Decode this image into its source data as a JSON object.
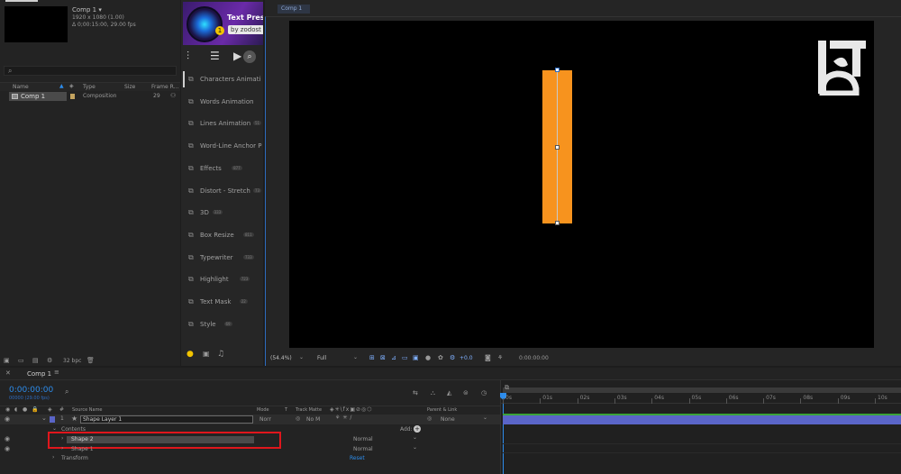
{
  "project": {
    "comp_name": "Comp 1 ▾",
    "comp_info_1": "1920 x 1080 (1.00)",
    "comp_info_2": "Δ 0;00:15:00, 29.00 fps",
    "columns": {
      "name": "Name",
      "type": "Type",
      "size": "Size",
      "frame_rate": "Frame R..."
    },
    "items": [
      {
        "name": "Comp 1",
        "type": "Composition",
        "size": "",
        "frame_rate": "29"
      }
    ],
    "bpc": "32 bpc"
  },
  "plugin": {
    "title": "Text Pres",
    "subtitle": "by zodost",
    "badge": "1",
    "items": [
      {
        "label": "Characters Animati",
        "count": ""
      },
      {
        "label": "Words Animation",
        "count": ""
      },
      {
        "label": "Lines Animation",
        "count": "51"
      },
      {
        "label": "Word-Line Anchor P",
        "count": ""
      },
      {
        "label": "Effects",
        "count": "877"
      },
      {
        "label": "Distort - Stretch",
        "count": "73"
      },
      {
        "label": "3D",
        "count": "333"
      },
      {
        "label": "Box Resize",
        "count": "811"
      },
      {
        "label": "Typewriter",
        "count": "733"
      },
      {
        "label": "Highlight",
        "count": "723"
      },
      {
        "label": "Text Mask",
        "count": "22"
      },
      {
        "label": "Style",
        "count": "69"
      }
    ]
  },
  "viewer": {
    "tab": "Comp 1",
    "zoom": "(54.4%)",
    "resolution": "Full",
    "exposure": "+0.0",
    "timecode": "0:00:00:00"
  },
  "timeline": {
    "tab": "Comp 1",
    "current_time": "0:00:00:00",
    "sub_time": "00000 (29.00 fps)",
    "headers": {
      "source": "Source Name",
      "mode": "Mode",
      "t": "T",
      "track_matte": "Track Matte",
      "parent": "Parent & Link"
    },
    "layer": {
      "index": "1",
      "name": "Shape Layer 1",
      "mode": "Norr",
      "matte": "No M",
      "parent": "None"
    },
    "contents_label": "Contents",
    "add_label": "Add:",
    "shapes": [
      {
        "name": "Shape 2",
        "mode": "Normal"
      },
      {
        "name": "Shape 1",
        "mode": "Normal"
      }
    ],
    "transform_label": "Transform",
    "reset_label": "Reset",
    "ruler": [
      "0s",
      "01s",
      "02s",
      "03s",
      "04s",
      "05s",
      "06s",
      "07s",
      "08s",
      "09s",
      "10s"
    ]
  },
  "colors": {
    "accent_blue": "#2d8ceb",
    "shape_orange": "#f7931e",
    "highlight_red": "#e0161c",
    "layer_bar": "#5a65c8"
  }
}
